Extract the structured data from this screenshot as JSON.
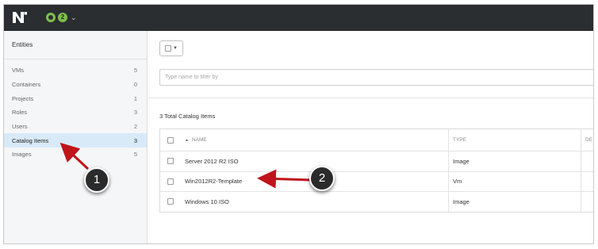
{
  "topbar": {
    "logo_icon": "nutanix-logo-icon",
    "status_icon": "health-ring-icon",
    "alert_count": "2",
    "menu_icon": "chevron-down-icon"
  },
  "sidebar": {
    "heading": "Entities",
    "items": [
      {
        "label": "VMs",
        "count": "5",
        "active": false
      },
      {
        "label": "Containers",
        "count": "0",
        "active": false
      },
      {
        "label": "Projects",
        "count": "1",
        "active": false
      },
      {
        "label": "Roles",
        "count": "3",
        "active": false
      },
      {
        "label": "Users",
        "count": "2",
        "active": false
      },
      {
        "label": "Catalog Items",
        "count": "3",
        "active": true
      },
      {
        "label": "Images",
        "count": "5",
        "active": false
      }
    ]
  },
  "main": {
    "filter": {
      "placeholder": "Type name to filter by",
      "value": ""
    },
    "total_label": "3 Total Catalog Items",
    "table": {
      "columns": [
        "NAME",
        "TYPE",
        "DE"
      ],
      "rows": [
        {
          "name": "Server 2012 R2 ISO",
          "type": "Image"
        },
        {
          "name": "Win2012R2-Template",
          "type": "Vm"
        },
        {
          "name": "Windows 10 ISO",
          "type": "Image"
        }
      ]
    }
  },
  "annotations": {
    "callout_1": "1",
    "callout_2": "2",
    "arrow_color": "#c0141b"
  },
  "colors": {
    "topbar": "#2b2e31",
    "accent_green": "#7fbf4d",
    "active_item": "#d8eaf8"
  }
}
